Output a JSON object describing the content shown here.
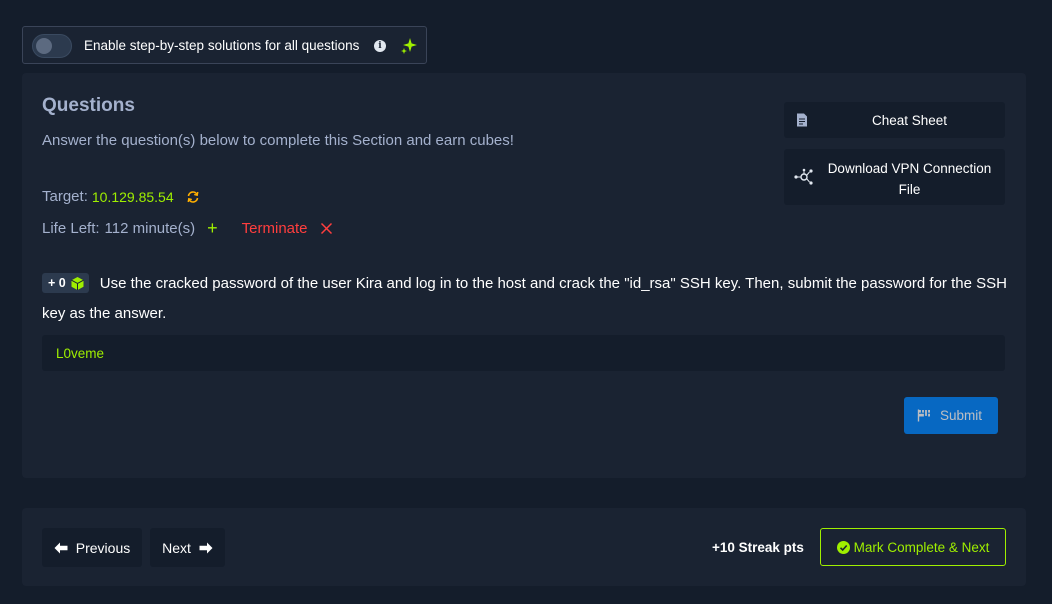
{
  "toggle": {
    "label": "Enable step-by-step solutions for all questions",
    "enabled": false
  },
  "questions": {
    "title": "Questions",
    "subtitle": "Answer the question(s) below to complete this Section and earn cubes!",
    "target_label": "Target:",
    "target_value": "10.129.85.54",
    "life_label": "Life Left:",
    "life_value": "112 minute(s)",
    "terminate_label": "Terminate",
    "cheat_sheet_label": "Cheat Sheet",
    "vpn_label": "Download VPN Connection File",
    "question": {
      "cube_reward": "+ 0",
      "text": "Use the cracked password of the user Kira and log in to the host and crack the \"id_rsa\" SSH key. Then, submit the password for the SSH key as the answer.",
      "answer_value": "L0veme"
    },
    "submit_label": "Submit"
  },
  "nav": {
    "previous_label": "Previous",
    "next_label": "Next",
    "streak_label": "+10 Streak pts",
    "mark_complete_label": "Mark Complete & Next"
  },
  "colors": {
    "accent_green": "#9fef00",
    "danger_red": "#ff3e3e",
    "primary_blue": "#0086ff",
    "panel_bg": "#1a2332",
    "page_bg": "#141d2b"
  },
  "icons": [
    "info-icon",
    "sparkle-icon",
    "refresh-icon",
    "plus-icon",
    "close-icon",
    "document-icon",
    "vpn-network-icon",
    "cube-icon",
    "flag-icon",
    "arrow-left-icon",
    "arrow-right-icon",
    "check-circle-icon"
  ]
}
